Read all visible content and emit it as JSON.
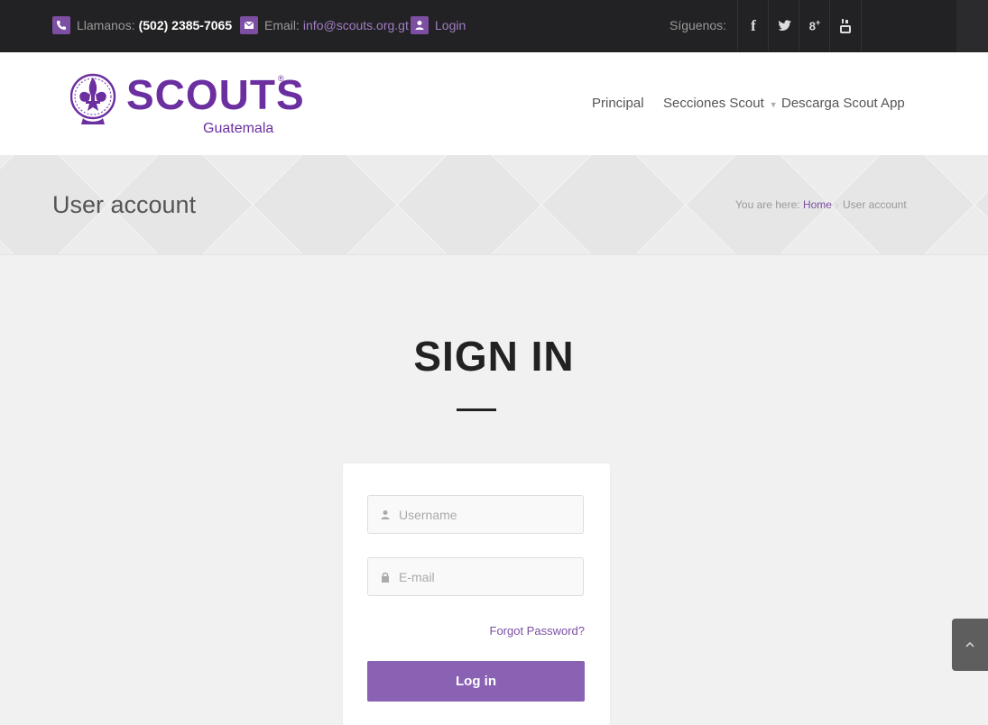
{
  "topbar": {
    "phone_label": "Llamanos:",
    "phone_value": "(502) 2385-7065",
    "email_label": "Email:",
    "email_value": "info@scouts.org.gt",
    "login_label": "Login",
    "follow_label": "Síguenos:",
    "social": [
      {
        "icon": "facebook-icon",
        "glyph": "f"
      },
      {
        "icon": "twitter-icon",
        "glyph": "🐦"
      },
      {
        "icon": "google-plus-icon",
        "glyph": "8+"
      },
      {
        "icon": "youtube-icon",
        "glyph": "▣"
      }
    ]
  },
  "header": {
    "logo_word": "SCOUTS",
    "logo_reg": "®",
    "logo_sub": "Guatemala",
    "nav": {
      "principal": "Principal",
      "secciones": "Secciones Scout",
      "descarga": "Descarga Scout App"
    }
  },
  "titlebar": {
    "title": "User account",
    "breadcrumb_prefix": "You are here:",
    "breadcrumb_home": "Home",
    "breadcrumb_current": "User account"
  },
  "signin": {
    "title": "SIGN IN",
    "username_placeholder": "Username",
    "email_placeholder": "E-mail",
    "forgot": "Forgot Password?",
    "login_button": "Log in"
  },
  "colors": {
    "brand_purple": "#6b2fa0",
    "button_purple": "#8a62b3",
    "topbar_bg": "#222224"
  }
}
